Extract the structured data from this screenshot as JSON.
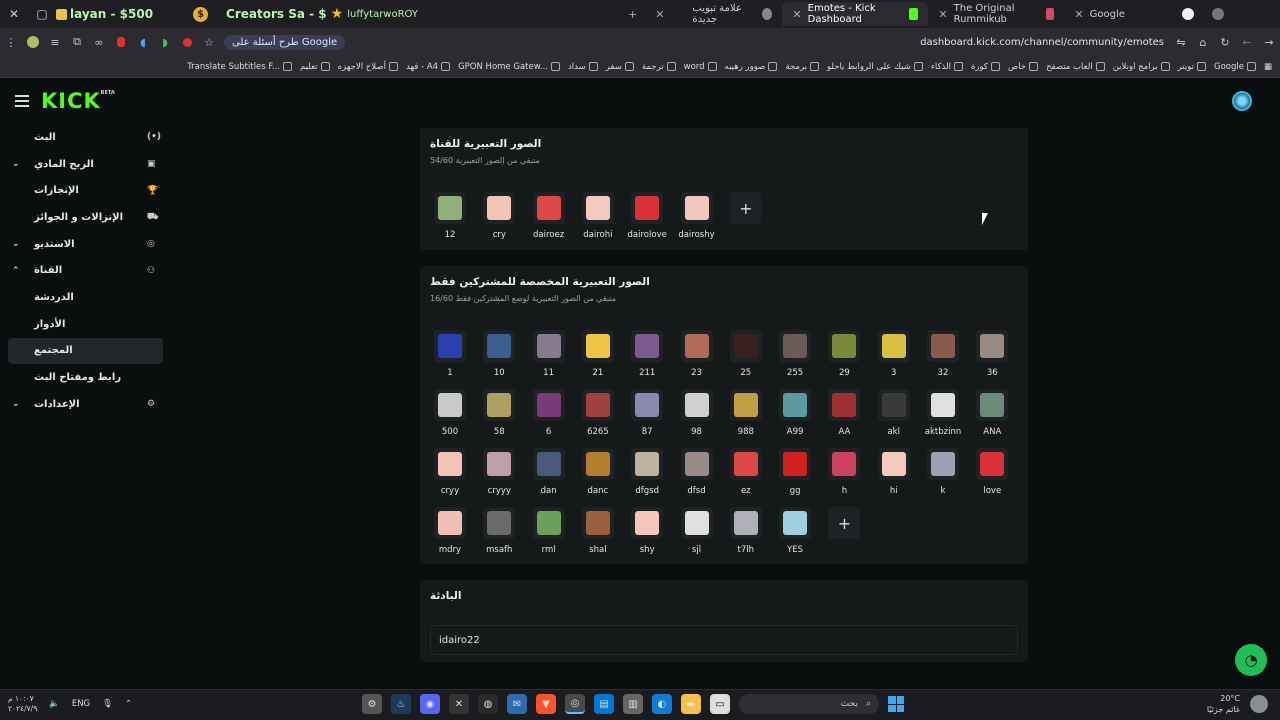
{
  "browser": {
    "overlay": {
      "text1": "layan - $500",
      "text2": "Creators Sa - $",
      "text3": "luffytarwoROY"
    },
    "tabs": [
      {
        "label": "علامة تبويب جديدة"
      },
      {
        "label": "Emotes - Kick Dashboard"
      },
      {
        "label": "The Original Rummikub"
      },
      {
        "label": "Google"
      }
    ],
    "google_pill": "طرح أسئلة على Google",
    "url": "dashboard.kick.com/channel/community/emotes",
    "bookmarks": [
      "Google",
      "تويتر",
      "برامج اونلاين",
      "العاب متصفح",
      "خاص",
      "كورة",
      "الذكاء",
      "شيك على الروابط ياحلو",
      "برمجة",
      "صوور رهيبه",
      "word",
      "ترجمة",
      "سفر",
      "سداد",
      "GPON Home Gatew...",
      "فهد - A4",
      "أصلاح الاجهزه",
      "تعليم",
      "Translate Subtitles F..."
    ]
  },
  "kick": {
    "logo": "KICK",
    "beta": "BETA"
  },
  "sidebar": {
    "items": [
      {
        "label": "البث",
        "chev": "",
        "icon": "(•)"
      },
      {
        "label": "الربح المادي",
        "chev": "⌄",
        "icon": "▣"
      },
      {
        "label": "الإنجازات",
        "chev": "",
        "icon": "🏆"
      },
      {
        "label": "الإنزالات و الجوائز",
        "chev": "",
        "icon": "⛟"
      },
      {
        "label": "الاستديو",
        "chev": "⌄",
        "icon": "◎"
      },
      {
        "label": "القناة",
        "chev": "⌃",
        "icon": "⚇"
      },
      {
        "label": "الدردشة",
        "chev": "",
        "icon": ""
      },
      {
        "label": "الأدوار",
        "chev": "",
        "icon": ""
      },
      {
        "label": "المجتمع",
        "chev": "",
        "icon": ""
      },
      {
        "label": "رابط ومفتاح البث",
        "chev": "",
        "icon": ""
      },
      {
        "label": "الإعدادات",
        "chev": "⌄",
        "icon": "⚙"
      }
    ]
  },
  "channel_emotes": {
    "title": "الصور التعبيرية للقناة",
    "subtitle": "متبقي من الصور التعبيرية 54/60",
    "emotes": [
      {
        "name": "12",
        "color": "#8fb07a"
      },
      {
        "name": "cry",
        "color": "#f2c4b8"
      },
      {
        "name": "dairoez",
        "color": "#e04848"
      },
      {
        "name": "dairohi",
        "color": "#f3c9c0"
      },
      {
        "name": "dairolove",
        "color": "#d9303a"
      },
      {
        "name": "dairoshy",
        "color": "#f2c6bd"
      }
    ]
  },
  "sub_emotes": {
    "title": "الصور التعبيرية المخصصة للمشتركين فقط",
    "subtitle": "متبقي من الصور التعبيرية لوضع المشتركين فقط 16/60",
    "emotes": [
      {
        "name": "1",
        "color": "#2a3fb0"
      },
      {
        "name": "10",
        "color": "#3c5e8e"
      },
      {
        "name": "11",
        "color": "#8a7a90"
      },
      {
        "name": "21",
        "color": "#f0c640"
      },
      {
        "name": "211",
        "color": "#7a5a90"
      },
      {
        "name": "23",
        "color": "#b06a5a"
      },
      {
        "name": "25",
        "color": "#3a2020"
      },
      {
        "name": "255",
        "color": "#6a5a58"
      },
      {
        "name": "29",
        "color": "#7a8a3a"
      },
      {
        "name": "3",
        "color": "#d9c040"
      },
      {
        "name": "32",
        "color": "#8a5a4a"
      },
      {
        "name": "36",
        "color": "#9a8a80"
      },
      {
        "name": "500",
        "color": "#c9c9c9"
      },
      {
        "name": "58",
        "color": "#b0a060"
      },
      {
        "name": "6",
        "color": "#7a3a7a"
      },
      {
        "name": "6265",
        "color": "#a04040"
      },
      {
        "name": "87",
        "color": "#8a8ab0"
      },
      {
        "name": "98",
        "color": "#d0d0d0"
      },
      {
        "name": "988",
        "color": "#c0a040"
      },
      {
        "name": "A99",
        "color": "#5a9aa0"
      },
      {
        "name": "AA",
        "color": "#a03030"
      },
      {
        "name": "akl",
        "color": "#3a3a3a"
      },
      {
        "name": "aktbzinn",
        "color": "#e0e0e0"
      },
      {
        "name": "ANA",
        "color": "#6a8a7a"
      },
      {
        "name": "cryy",
        "color": "#f2c4b8"
      },
      {
        "name": "cryyy",
        "color": "#c0a0a8"
      },
      {
        "name": "dan",
        "color": "#4a5a7a"
      },
      {
        "name": "danc",
        "color": "#b08030"
      },
      {
        "name": "dfgsd",
        "color": "#c0b0a0"
      },
      {
        "name": "dfsd",
        "color": "#9a8a8a"
      },
      {
        "name": "ez",
        "color": "#e04848"
      },
      {
        "name": "gg",
        "color": "#d02020"
      },
      {
        "name": "h",
        "color": "#d04060"
      },
      {
        "name": "hi",
        "color": "#f3c9c0"
      },
      {
        "name": "k",
        "color": "#a0a0b0"
      },
      {
        "name": "love",
        "color": "#d9303a"
      },
      {
        "name": "mdry",
        "color": "#f0c0b8"
      },
      {
        "name": "msafh",
        "color": "#6a6a6a"
      },
      {
        "name": "rml",
        "color": "#6aa05a"
      },
      {
        "name": "shal",
        "color": "#9a6040"
      },
      {
        "name": "shy",
        "color": "#f2c6bd"
      },
      {
        "name": "sjl",
        "color": "#e0e0e0"
      },
      {
        "name": "t7lh",
        "color": "#b0b0b8"
      },
      {
        "name": "YES",
        "color": "#a0d0e0"
      }
    ]
  },
  "bio": {
    "title": "البادئة",
    "value": "idairo22"
  },
  "taskbar": {
    "time": "١٠:٠٧ م",
    "date": "٢٠٢٤/٧/٩",
    "lang": "ENG",
    "search_placeholder": "بحث",
    "temp": "20°C",
    "weather": "غائم جزئيًا"
  }
}
